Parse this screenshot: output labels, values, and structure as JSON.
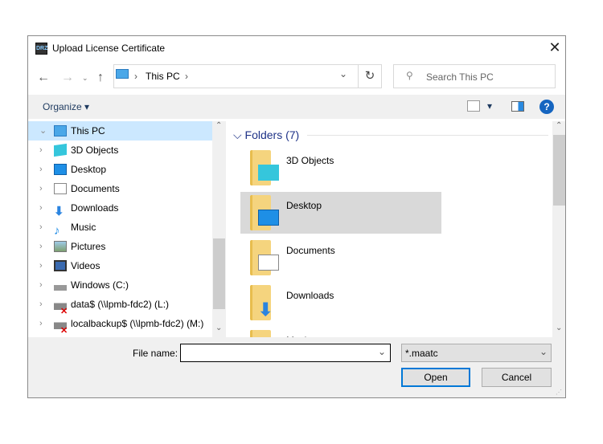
{
  "window": {
    "title": "Upload License Certificate",
    "app_icon_text": "DRZ"
  },
  "address": {
    "crumb": "This PC",
    "search_placeholder": "Search This PC"
  },
  "toolbar": {
    "organize": "Organize"
  },
  "tree": [
    {
      "label": "This PC",
      "icon": "computer-icon",
      "expanded": true,
      "selected": true
    },
    {
      "label": "3D Objects",
      "icon": "cube-icon"
    },
    {
      "label": "Desktop",
      "icon": "desktop-icon"
    },
    {
      "label": "Documents",
      "icon": "document-icon"
    },
    {
      "label": "Downloads",
      "icon": "download-arrow-icon"
    },
    {
      "label": "Music",
      "icon": "music-note-icon"
    },
    {
      "label": "Pictures",
      "icon": "picture-icon"
    },
    {
      "label": "Videos",
      "icon": "film-icon"
    },
    {
      "label": "Windows (C:)",
      "icon": "drive-icon"
    },
    {
      "label": "data$ (\\\\lpmb-fdc2) (L:)",
      "icon": "disconnected-drive-icon"
    },
    {
      "label": "localbackup$ (\\\\lpmb-fdc2) (M:)",
      "icon": "disconnected-drive-icon"
    }
  ],
  "content": {
    "group_header": "Folders (7)",
    "folders": [
      {
        "label": "3D Objects",
        "selected": false
      },
      {
        "label": "Desktop",
        "selected": true
      },
      {
        "label": "Documents",
        "selected": false
      },
      {
        "label": "Downloads",
        "selected": false
      },
      {
        "label": "Music",
        "selected": false
      }
    ]
  },
  "footer": {
    "filename_label": "File name:",
    "filename_value": "",
    "filter": "*.maatc",
    "open": "Open",
    "cancel": "Cancel"
  }
}
